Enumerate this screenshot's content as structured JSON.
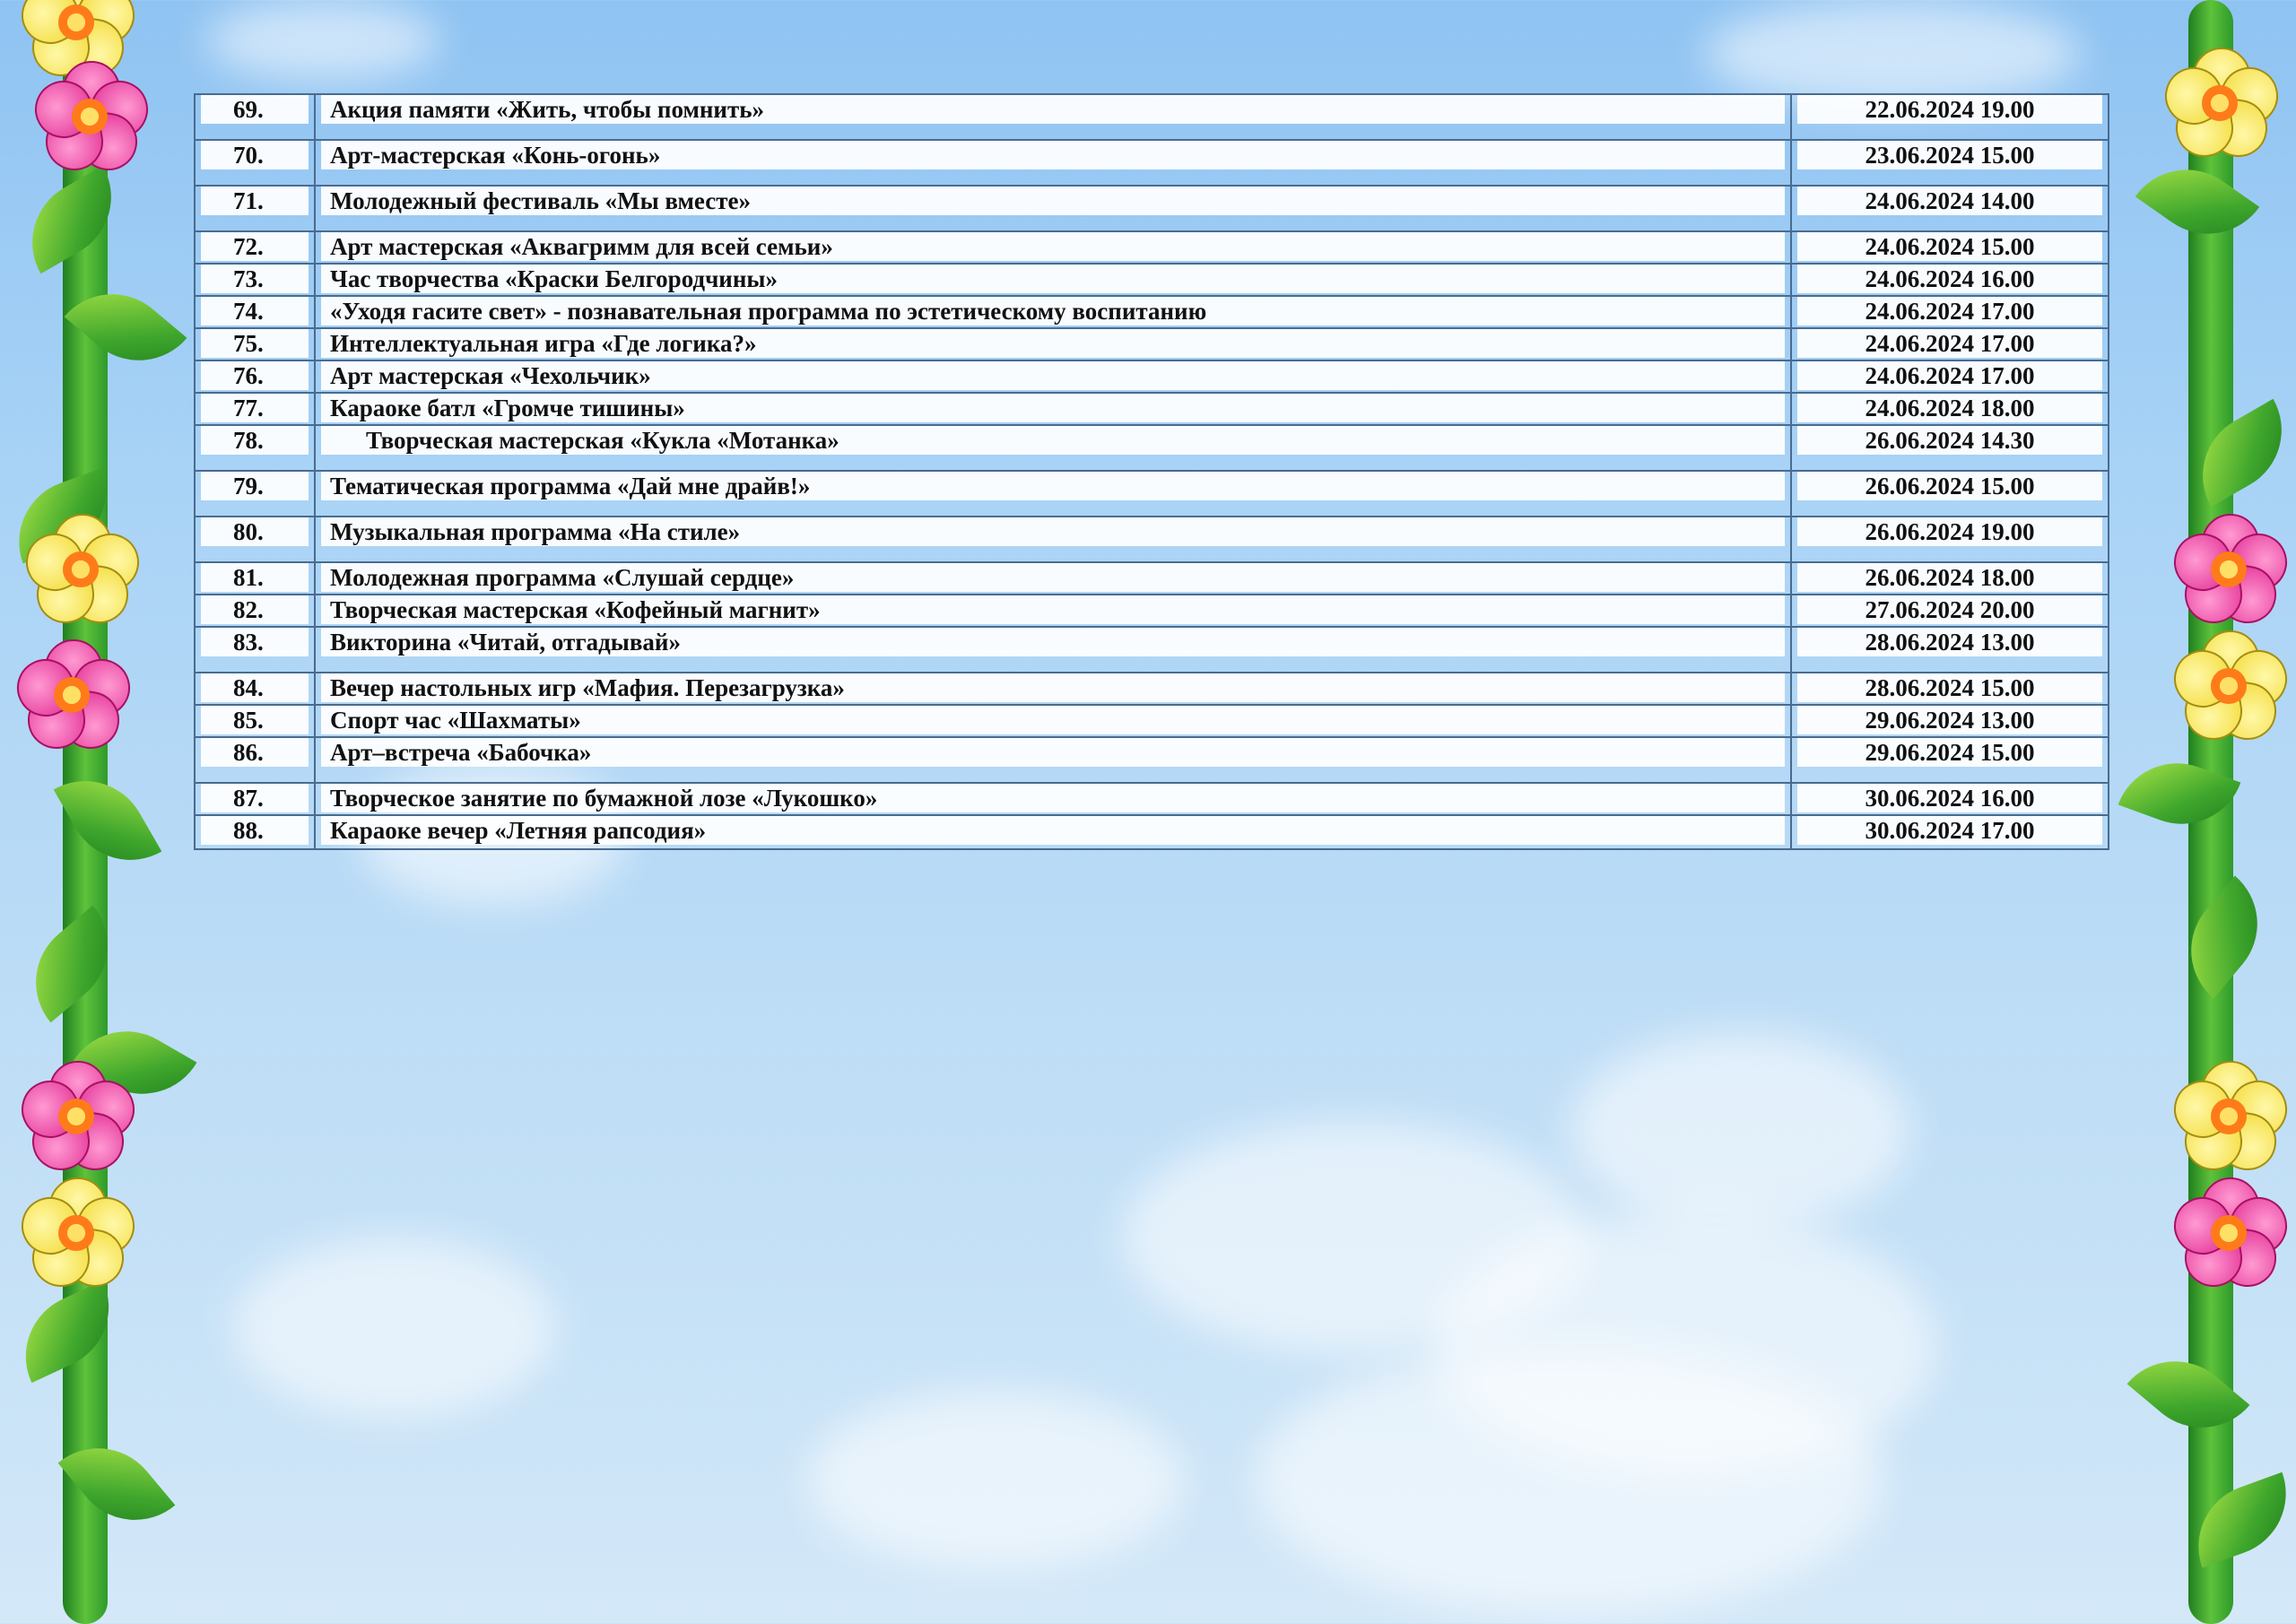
{
  "schedule": {
    "rows": [
      {
        "num": "69.",
        "title": "Акция памяти «Жить, чтобы помнить»",
        "date": "22.06.2024 19.00"
      },
      {
        "num": "70.",
        "title": "Арт-мастерская «Конь-огонь»",
        "date": "23.06.2024 15.00"
      },
      {
        "num": "71.",
        "title": "Молодежный фестиваль «Мы вместе»",
        "date": "24.06.2024 14.00"
      },
      {
        "num": "72.",
        "title": "Арт мастерская «Аквагримм для всей семьи»",
        "date": "24.06.2024 15.00"
      },
      {
        "num": "73.",
        "title": "Час творчества «Краски Белгородчины»",
        "date": "24.06.2024 16.00"
      },
      {
        "num": "74.",
        "title": "«Уходя гасите свет» - познавательная программа по эстетическому воспитанию",
        "date": "24.06.2024 17.00"
      },
      {
        "num": "75.",
        "title": "Интеллектуальная игра «Где логика?»",
        "date": "24.06.2024 17.00"
      },
      {
        "num": "76.",
        "title": "Арт мастерская «Чехольчик»",
        "date": "24.06.2024 17.00"
      },
      {
        "num": "77.",
        "title": "Караоке батл «Громче тишины»",
        "date": "24.06.2024 18.00"
      },
      {
        "num": "78.",
        "title": "Творческая мастерская «Кукла «Мотанка»",
        "date": "26.06.2024 14.30"
      },
      {
        "num": "79.",
        "title": "Тематическая программа «Дай мне драйв!»",
        "date": "26.06.2024 15.00"
      },
      {
        "num": "80.",
        "title": "Музыкальная программа «На стиле»",
        "date": "26.06.2024 19.00"
      },
      {
        "num": "81.",
        "title": "Молодежная программа «Слушай сердце»",
        "date": "26.06.2024 18.00"
      },
      {
        "num": "82.",
        "title": "Творческая мастерская «Кофейный магнит»",
        "date": "27.06.2024 20.00"
      },
      {
        "num": "83.",
        "title": "Викторина «Читай, отгадывай»",
        "date": "28.06.2024 13.00"
      },
      {
        "num": "84.",
        "title": "Вечер настольных игр «Мафия. Перезагрузка»",
        "date": "28.06.2024 15.00"
      },
      {
        "num": "85.",
        "title": "Спорт час «Шахматы»",
        "date": "29.06.2024 13.00"
      },
      {
        "num": "86.",
        "title": "Арт–встреча «Бабочка»",
        "date": "29.06.2024 15.00"
      },
      {
        "num": "87.",
        "title": "Творческое занятие по бумажной лозе «Лукошко»",
        "date": "30.06.2024 16.00"
      },
      {
        "num": "88.",
        "title": "Караоке вечер «Летняя рапсодия»",
        "date": "30.06.2024 17.00"
      }
    ]
  },
  "colors": {
    "sky": "#a9d3f6",
    "table_border": "#4a6b8f",
    "flower_pink": "#e0268f",
    "flower_yellow": "#f2d82e",
    "vine_green": "#3ea62c"
  }
}
